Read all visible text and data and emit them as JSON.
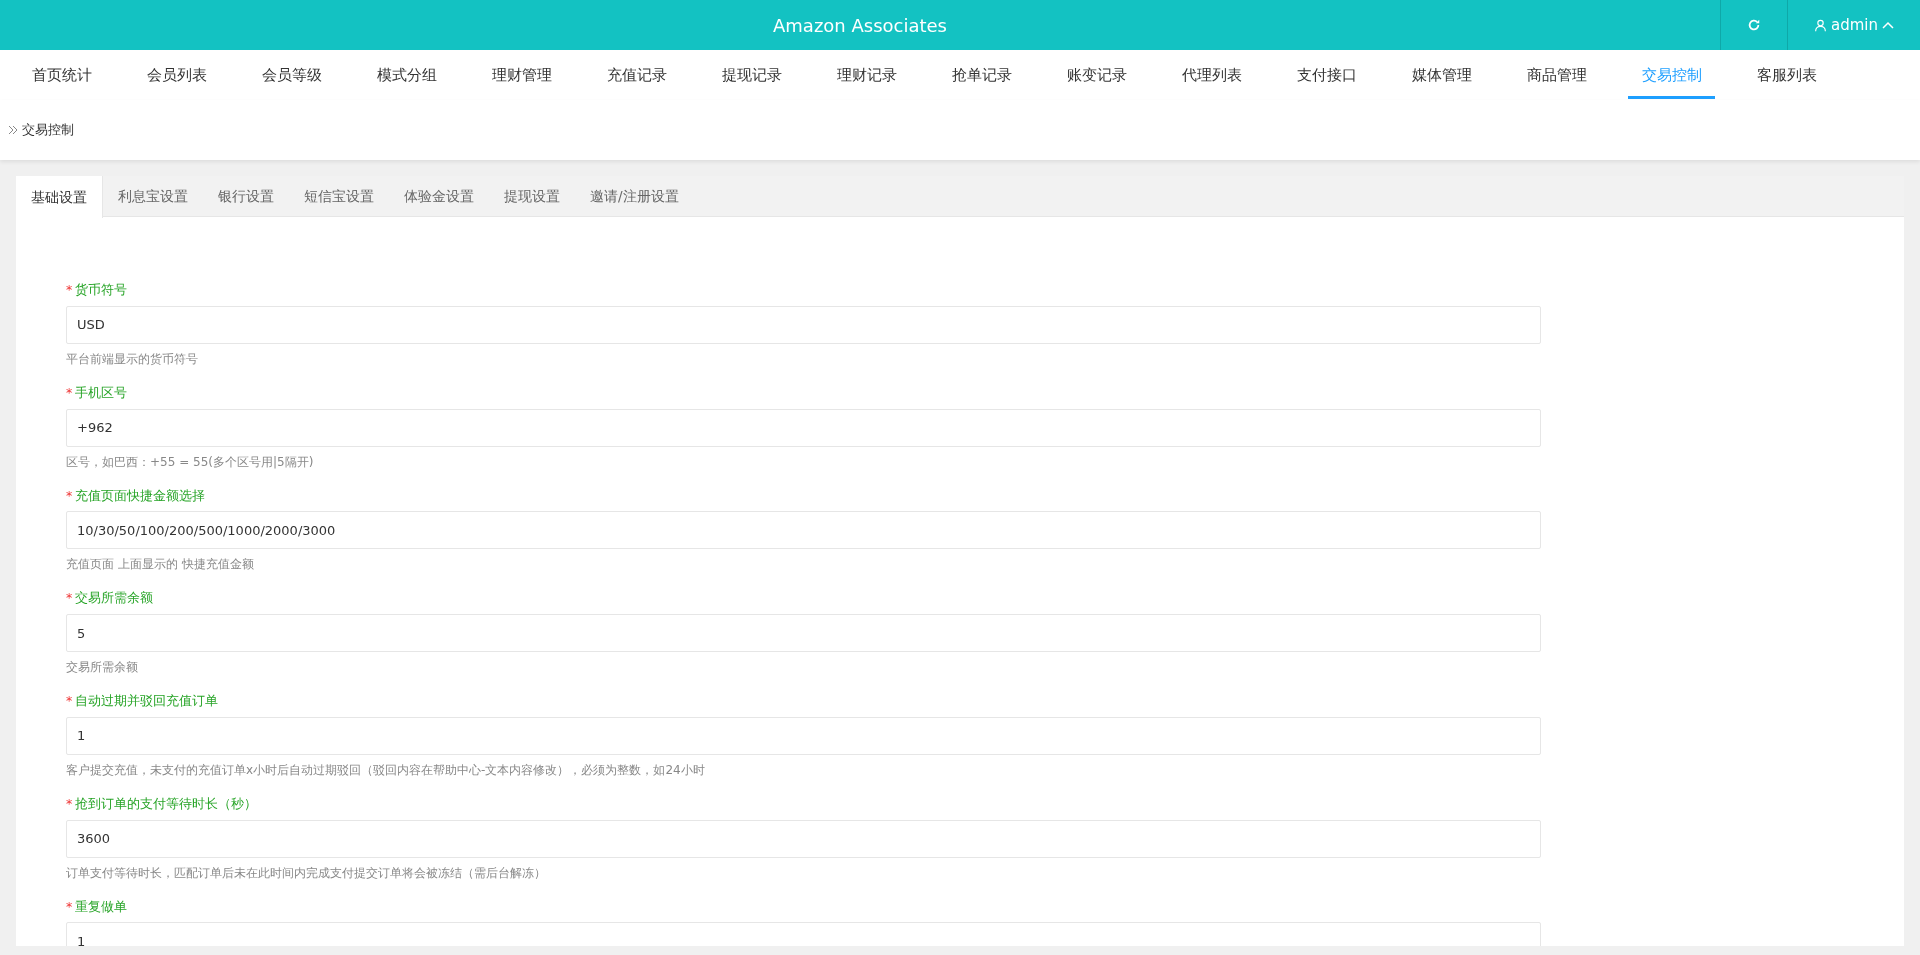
{
  "header": {
    "title": "Amazon Associates",
    "user": "admin"
  },
  "nav": [
    {
      "label": "首页统计",
      "selected": false
    },
    {
      "label": "会员列表",
      "selected": false
    },
    {
      "label": "会员等级",
      "selected": false
    },
    {
      "label": "模式分组",
      "selected": false
    },
    {
      "label": "理财管理",
      "selected": false
    },
    {
      "label": "充值记录",
      "selected": false
    },
    {
      "label": "提现记录",
      "selected": false
    },
    {
      "label": "理财记录",
      "selected": false
    },
    {
      "label": "抢单记录",
      "selected": false
    },
    {
      "label": "账变记录",
      "selected": false
    },
    {
      "label": "代理列表",
      "selected": false
    },
    {
      "label": "支付接口",
      "selected": false
    },
    {
      "label": "媒体管理",
      "selected": false
    },
    {
      "label": "商品管理",
      "selected": false
    },
    {
      "label": "交易控制",
      "selected": true
    },
    {
      "label": "客服列表",
      "selected": false
    }
  ],
  "breadcrumb": "交易控制",
  "tabs": [
    {
      "label": "基础设置",
      "selected": true
    },
    {
      "label": "利息宝设置",
      "selected": false
    },
    {
      "label": "银行设置",
      "selected": false
    },
    {
      "label": "短信宝设置",
      "selected": false
    },
    {
      "label": "体验金设置",
      "selected": false
    },
    {
      "label": "提现设置",
      "selected": false
    },
    {
      "label": "邀请/注册设置",
      "selected": false
    }
  ],
  "fields": [
    {
      "label": "货币符号",
      "marker": "*",
      "value": "USD",
      "help": "平台前端显示的货币符号"
    },
    {
      "label": "手机区号",
      "marker": "*",
      "value": "+962",
      "help": "区号，如巴西：+55 = 55(多个区号用|5隔开)"
    },
    {
      "label": "充值页面快捷金额选择",
      "marker": "*",
      "value": "10/30/50/100/200/500/1000/2000/3000",
      "help": "充值页面 上面显示的 快捷充值金额"
    },
    {
      "label": "交易所需余额",
      "marker": "*",
      "value": "5",
      "help": "交易所需余额"
    },
    {
      "label": "自动过期并驳回充值订单",
      "marker": "*",
      "value": "1",
      "help": "客户提交充值，未支付的充值订单x小时后自动过期驳回（驳回内容在帮助中心-文本内容修改），必须为整数，如24小时"
    },
    {
      "label": "抢到订单的支付等待时长（秒）",
      "marker": "*",
      "value": "3600",
      "help": "订单支付等待时长，匹配订单后未在此时间内完成支付提交订单将会被冻结（需后台解冻）"
    },
    {
      "label": "重复做单",
      "marker": "*",
      "value": "1"
    }
  ]
}
